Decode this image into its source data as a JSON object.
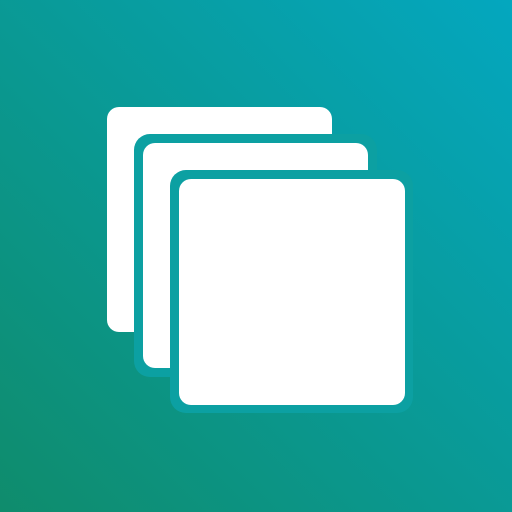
{
  "icon": {
    "name": "stacked-layers-icon",
    "colors": {
      "gradient_start": "#0F8C6C",
      "gradient_end": "#04A7BF",
      "gap": "#0CA0A2",
      "card": "#FFFFFF"
    }
  }
}
